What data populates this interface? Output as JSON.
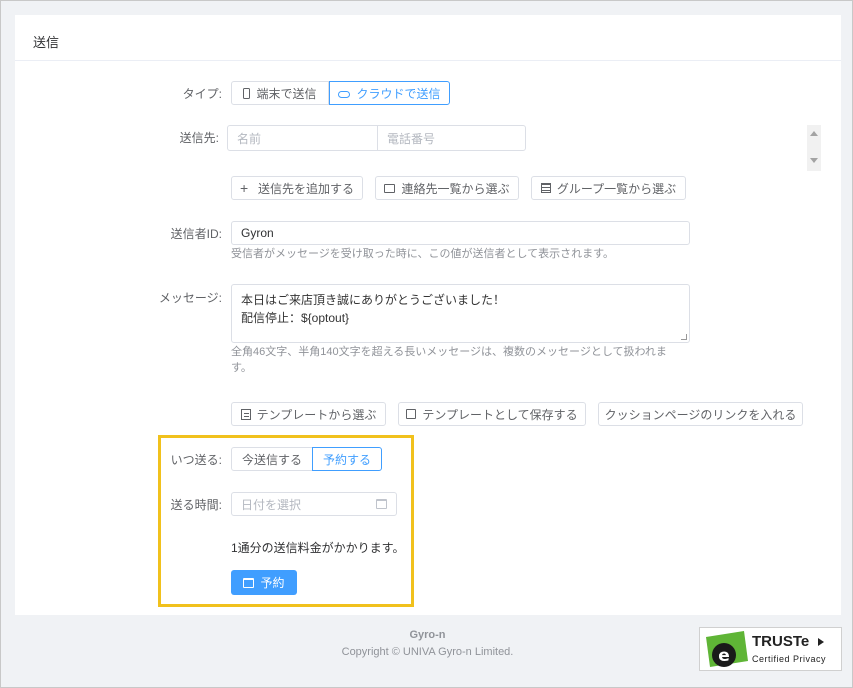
{
  "header": {
    "title": "送信"
  },
  "type": {
    "label": "タイプ:",
    "options": [
      "端末で送信",
      "クラウドで送信"
    ]
  },
  "recipients": {
    "label": "送信先:",
    "name_placeholder": "名前",
    "phone_placeholder": "電話番号",
    "buttons": [
      "送信先を追加する",
      "連絡先一覧から選ぶ",
      "グループ一覧から選ぶ"
    ]
  },
  "sender": {
    "label": "送信者ID:",
    "value": "Gyron",
    "help": "受信者がメッセージを受け取った時に、この値が送信者として表示されます。"
  },
  "message": {
    "label": "メッセージ:",
    "line1": "本日はご来店頂き誠にありがとうございました！",
    "line2": "配信停止：${optout}",
    "help_line1": "全角46文字、半角140文字を超える長いメッセージは、複数のメッセージとして扱われま",
    "help_line2": "す。",
    "buttons": [
      "テンプレートから選ぶ",
      "テンプレートとして保存する",
      "クッションページのリンクを入れる"
    ]
  },
  "when": {
    "label": "いつ送る:",
    "options": [
      "今送信する",
      "予約する"
    ]
  },
  "time": {
    "label": "送る時間:",
    "placeholder": "日付を選択"
  },
  "cost_note": "1通分の送信料金がかかります。",
  "submit_label": "予約",
  "footer": {
    "company": "Gyro-n",
    "copyright": "Copyright © UNIVA Gyro-n Limited."
  },
  "badge": {
    "brand": "TRUSTe",
    "sub": "Certified Privacy"
  },
  "colors": {
    "primary": "#409eff",
    "highlight": "#f1c11c"
  }
}
